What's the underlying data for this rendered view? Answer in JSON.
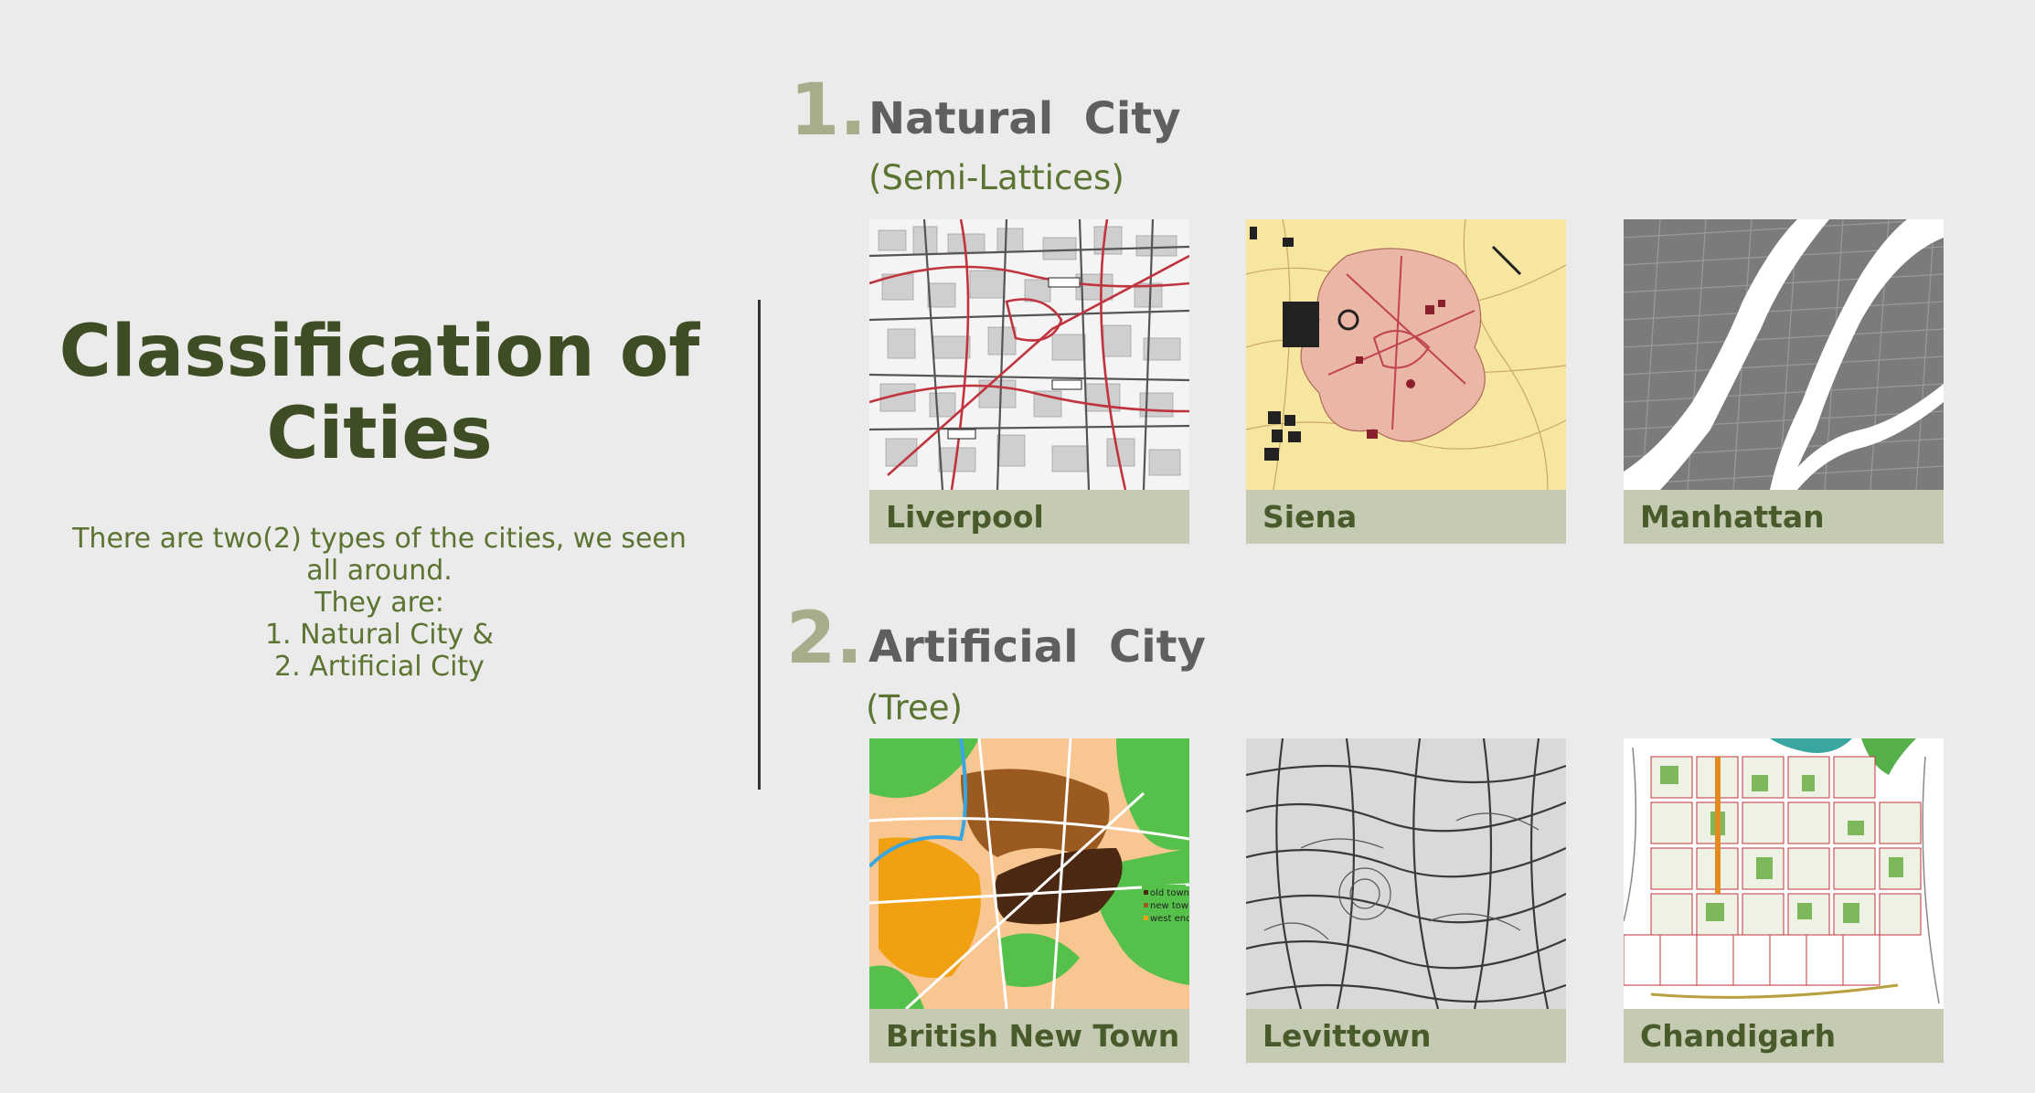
{
  "left": {
    "title_line1": "Classification of",
    "title_line2": "Cities",
    "intro_lines": [
      "There are two(2) types of the cities, we seen",
      "all around.",
      "They are:",
      "1. Natural  City &",
      "2. Artificial  City"
    ]
  },
  "sections": [
    {
      "number": "1.",
      "title": "Natural  City",
      "subtitle": "(Semi-Lattices)",
      "cards": [
        {
          "label": "Liverpool"
        },
        {
          "label": "Siena"
        },
        {
          "label": "Manhattan"
        }
      ]
    },
    {
      "number": "2.",
      "title": "Artificial  City",
      "subtitle": "(Tree)",
      "cards": [
        {
          "label": "British New Town"
        },
        {
          "label": "Levittown"
        },
        {
          "label": "Chandigarh"
        }
      ]
    }
  ],
  "map_legend": {
    "old_town": "old town",
    "new_town": "new town",
    "west_end": "west end"
  },
  "colors": {
    "background": "#ebebeb",
    "title_green": "#3e4d23",
    "text_green": "#5b7431",
    "number_gray": "#a6ad8a",
    "heading_gray": "#5f5f5f",
    "label_bg": "#c5cab2",
    "label_text": "#495b2a"
  }
}
